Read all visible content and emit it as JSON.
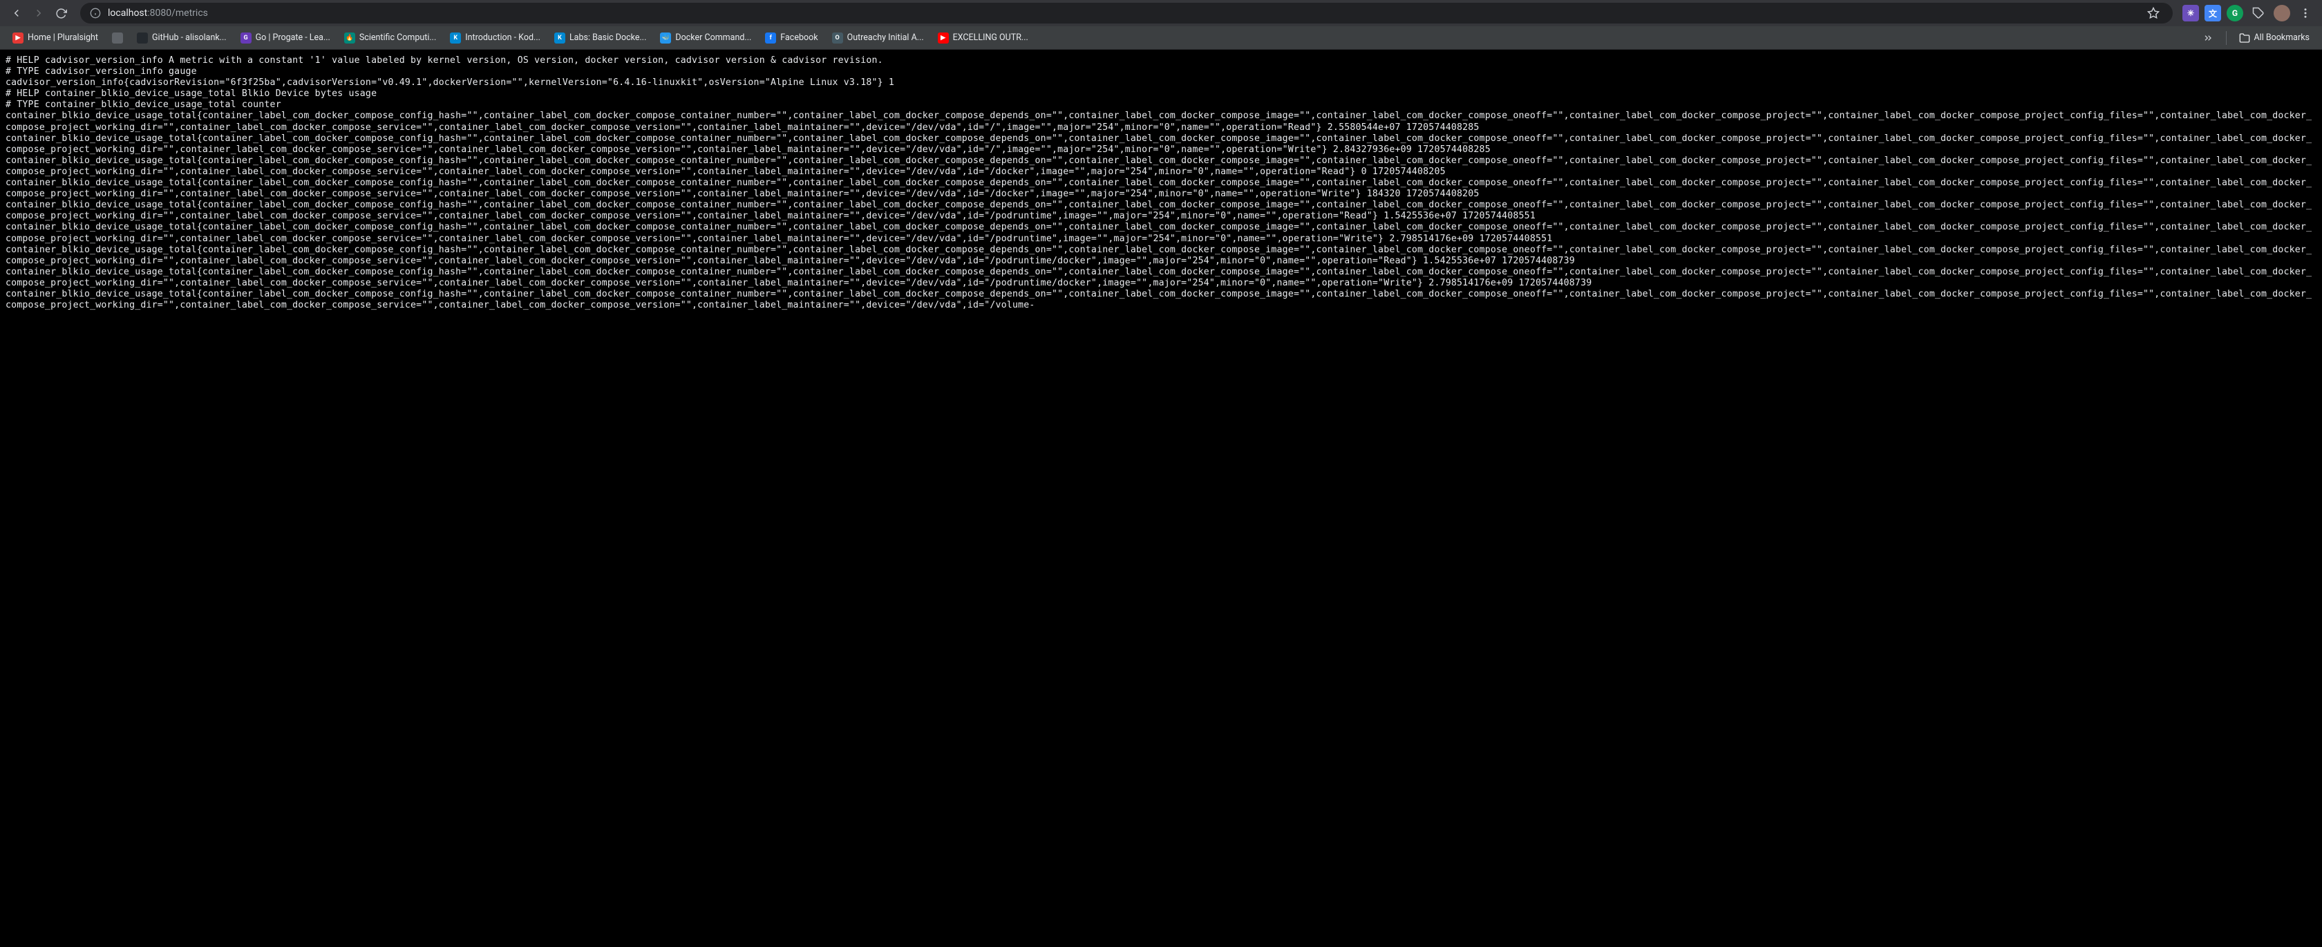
{
  "browser": {
    "url_host": "localhost",
    "url_port_path": ":8080/metrics",
    "all_bookmarks_label": "All Bookmarks",
    "bookmarks": [
      {
        "label": "Home | Pluralsight",
        "favicon": "bm-red",
        "glyph": "▶"
      },
      {
        "label": "",
        "favicon": "bm-gray",
        "glyph": ""
      },
      {
        "label": "GitHub - alisolank...",
        "favicon": "bm-dark",
        "glyph": ""
      },
      {
        "label": "Go | Progate - Lea...",
        "favicon": "bm-purple",
        "glyph": "G"
      },
      {
        "label": "Scientific Computi...",
        "favicon": "bm-teal",
        "glyph": "🔥"
      },
      {
        "label": "Introduction - Kod...",
        "favicon": "bm-cyan",
        "glyph": "K"
      },
      {
        "label": "Labs: Basic Docke...",
        "favicon": "bm-cyan",
        "glyph": "K"
      },
      {
        "label": "Docker Command...",
        "favicon": "bm-docker",
        "glyph": "🐳"
      },
      {
        "label": "Facebook",
        "favicon": "bm-fb",
        "glyph": "f"
      },
      {
        "label": "Outreachy Initial A...",
        "favicon": "bm-outreachy",
        "glyph": "O"
      },
      {
        "label": "EXCELLING OUTR...",
        "favicon": "bm-yt",
        "glyph": "▶"
      }
    ]
  },
  "metrics_text": "# HELP cadvisor_version_info A metric with a constant '1' value labeled by kernel version, OS version, docker version, cadvisor version & cadvisor revision.\n# TYPE cadvisor_version_info gauge\ncadvisor_version_info{cadvisorRevision=\"6f3f25ba\",cadvisorVersion=\"v0.49.1\",dockerVersion=\"\",kernelVersion=\"6.4.16-linuxkit\",osVersion=\"Alpine Linux v3.18\"} 1\n# HELP container_blkio_device_usage_total Blkio Device bytes usage\n# TYPE container_blkio_device_usage_total counter\ncontainer_blkio_device_usage_total{container_label_com_docker_compose_config_hash=\"\",container_label_com_docker_compose_container_number=\"\",container_label_com_docker_compose_depends_on=\"\",container_label_com_docker_compose_image=\"\",container_label_com_docker_compose_oneoff=\"\",container_label_com_docker_compose_project=\"\",container_label_com_docker_compose_project_config_files=\"\",container_label_com_docker_compose_project_working_dir=\"\",container_label_com_docker_compose_service=\"\",container_label_com_docker_compose_version=\"\",container_label_maintainer=\"\",device=\"/dev/vda\",id=\"/\",image=\"\",major=\"254\",minor=\"0\",name=\"\",operation=\"Read\"} 2.5580544e+07 1720574408285\ncontainer_blkio_device_usage_total{container_label_com_docker_compose_config_hash=\"\",container_label_com_docker_compose_container_number=\"\",container_label_com_docker_compose_depends_on=\"\",container_label_com_docker_compose_image=\"\",container_label_com_docker_compose_oneoff=\"\",container_label_com_docker_compose_project=\"\",container_label_com_docker_compose_project_config_files=\"\",container_label_com_docker_compose_project_working_dir=\"\",container_label_com_docker_compose_service=\"\",container_label_com_docker_compose_version=\"\",container_label_maintainer=\"\",device=\"/dev/vda\",id=\"/\",image=\"\",major=\"254\",minor=\"0\",name=\"\",operation=\"Write\"} 2.84327936e+09 1720574408285\ncontainer_blkio_device_usage_total{container_label_com_docker_compose_config_hash=\"\",container_label_com_docker_compose_container_number=\"\",container_label_com_docker_compose_depends_on=\"\",container_label_com_docker_compose_image=\"\",container_label_com_docker_compose_oneoff=\"\",container_label_com_docker_compose_project=\"\",container_label_com_docker_compose_project_config_files=\"\",container_label_com_docker_compose_project_working_dir=\"\",container_label_com_docker_compose_service=\"\",container_label_com_docker_compose_version=\"\",container_label_maintainer=\"\",device=\"/dev/vda\",id=\"/docker\",image=\"\",major=\"254\",minor=\"0\",name=\"\",operation=\"Read\"} 0 1720574408205\ncontainer_blkio_device_usage_total{container_label_com_docker_compose_config_hash=\"\",container_label_com_docker_compose_container_number=\"\",container_label_com_docker_compose_depends_on=\"\",container_label_com_docker_compose_image=\"\",container_label_com_docker_compose_oneoff=\"\",container_label_com_docker_compose_project=\"\",container_label_com_docker_compose_project_config_files=\"\",container_label_com_docker_compose_project_working_dir=\"\",container_label_com_docker_compose_service=\"\",container_label_com_docker_compose_version=\"\",container_label_maintainer=\"\",device=\"/dev/vda\",id=\"/docker\",image=\"\",major=\"254\",minor=\"0\",name=\"\",operation=\"Write\"} 184320 1720574408205\ncontainer_blkio_device_usage_total{container_label_com_docker_compose_config_hash=\"\",container_label_com_docker_compose_container_number=\"\",container_label_com_docker_compose_depends_on=\"\",container_label_com_docker_compose_image=\"\",container_label_com_docker_compose_oneoff=\"\",container_label_com_docker_compose_project=\"\",container_label_com_docker_compose_project_config_files=\"\",container_label_com_docker_compose_project_working_dir=\"\",container_label_com_docker_compose_service=\"\",container_label_com_docker_compose_version=\"\",container_label_maintainer=\"\",device=\"/dev/vda\",id=\"/podruntime\",image=\"\",major=\"254\",minor=\"0\",name=\"\",operation=\"Read\"} 1.5425536e+07 1720574408551\ncontainer_blkio_device_usage_total{container_label_com_docker_compose_config_hash=\"\",container_label_com_docker_compose_container_number=\"\",container_label_com_docker_compose_depends_on=\"\",container_label_com_docker_compose_image=\"\",container_label_com_docker_compose_oneoff=\"\",container_label_com_docker_compose_project=\"\",container_label_com_docker_compose_project_config_files=\"\",container_label_com_docker_compose_project_working_dir=\"\",container_label_com_docker_compose_service=\"\",container_label_com_docker_compose_version=\"\",container_label_maintainer=\"\",device=\"/dev/vda\",id=\"/podruntime\",image=\"\",major=\"254\",minor=\"0\",name=\"\",operation=\"Write\"} 2.798514176e+09 1720574408551\ncontainer_blkio_device_usage_total{container_label_com_docker_compose_config_hash=\"\",container_label_com_docker_compose_container_number=\"\",container_label_com_docker_compose_depends_on=\"\",container_label_com_docker_compose_image=\"\",container_label_com_docker_compose_oneoff=\"\",container_label_com_docker_compose_project=\"\",container_label_com_docker_compose_project_config_files=\"\",container_label_com_docker_compose_project_working_dir=\"\",container_label_com_docker_compose_service=\"\",container_label_com_docker_compose_version=\"\",container_label_maintainer=\"\",device=\"/dev/vda\",id=\"/podruntime/docker\",image=\"\",major=\"254\",minor=\"0\",name=\"\",operation=\"Read\"} 1.5425536e+07 1720574408739\ncontainer_blkio_device_usage_total{container_label_com_docker_compose_config_hash=\"\",container_label_com_docker_compose_container_number=\"\",container_label_com_docker_compose_depends_on=\"\",container_label_com_docker_compose_image=\"\",container_label_com_docker_compose_oneoff=\"\",container_label_com_docker_compose_project=\"\",container_label_com_docker_compose_project_config_files=\"\",container_label_com_docker_compose_project_working_dir=\"\",container_label_com_docker_compose_service=\"\",container_label_com_docker_compose_version=\"\",container_label_maintainer=\"\",device=\"/dev/vda\",id=\"/podruntime/docker\",image=\"\",major=\"254\",minor=\"0\",name=\"\",operation=\"Write\"} 2.798514176e+09 1720574408739\ncontainer_blkio_device_usage_total{container_label_com_docker_compose_config_hash=\"\",container_label_com_docker_compose_container_number=\"\",container_label_com_docker_compose_depends_on=\"\",container_label_com_docker_compose_image=\"\",container_label_com_docker_compose_oneoff=\"\",container_label_com_docker_compose_project=\"\",container_label_com_docker_compose_project_config_files=\"\",container_label_com_docker_compose_project_working_dir=\"\",container_label_com_docker_compose_service=\"\",container_label_com_docker_compose_version=\"\",container_label_maintainer=\"\",device=\"/dev/vda\",id=\"/volume-"
}
